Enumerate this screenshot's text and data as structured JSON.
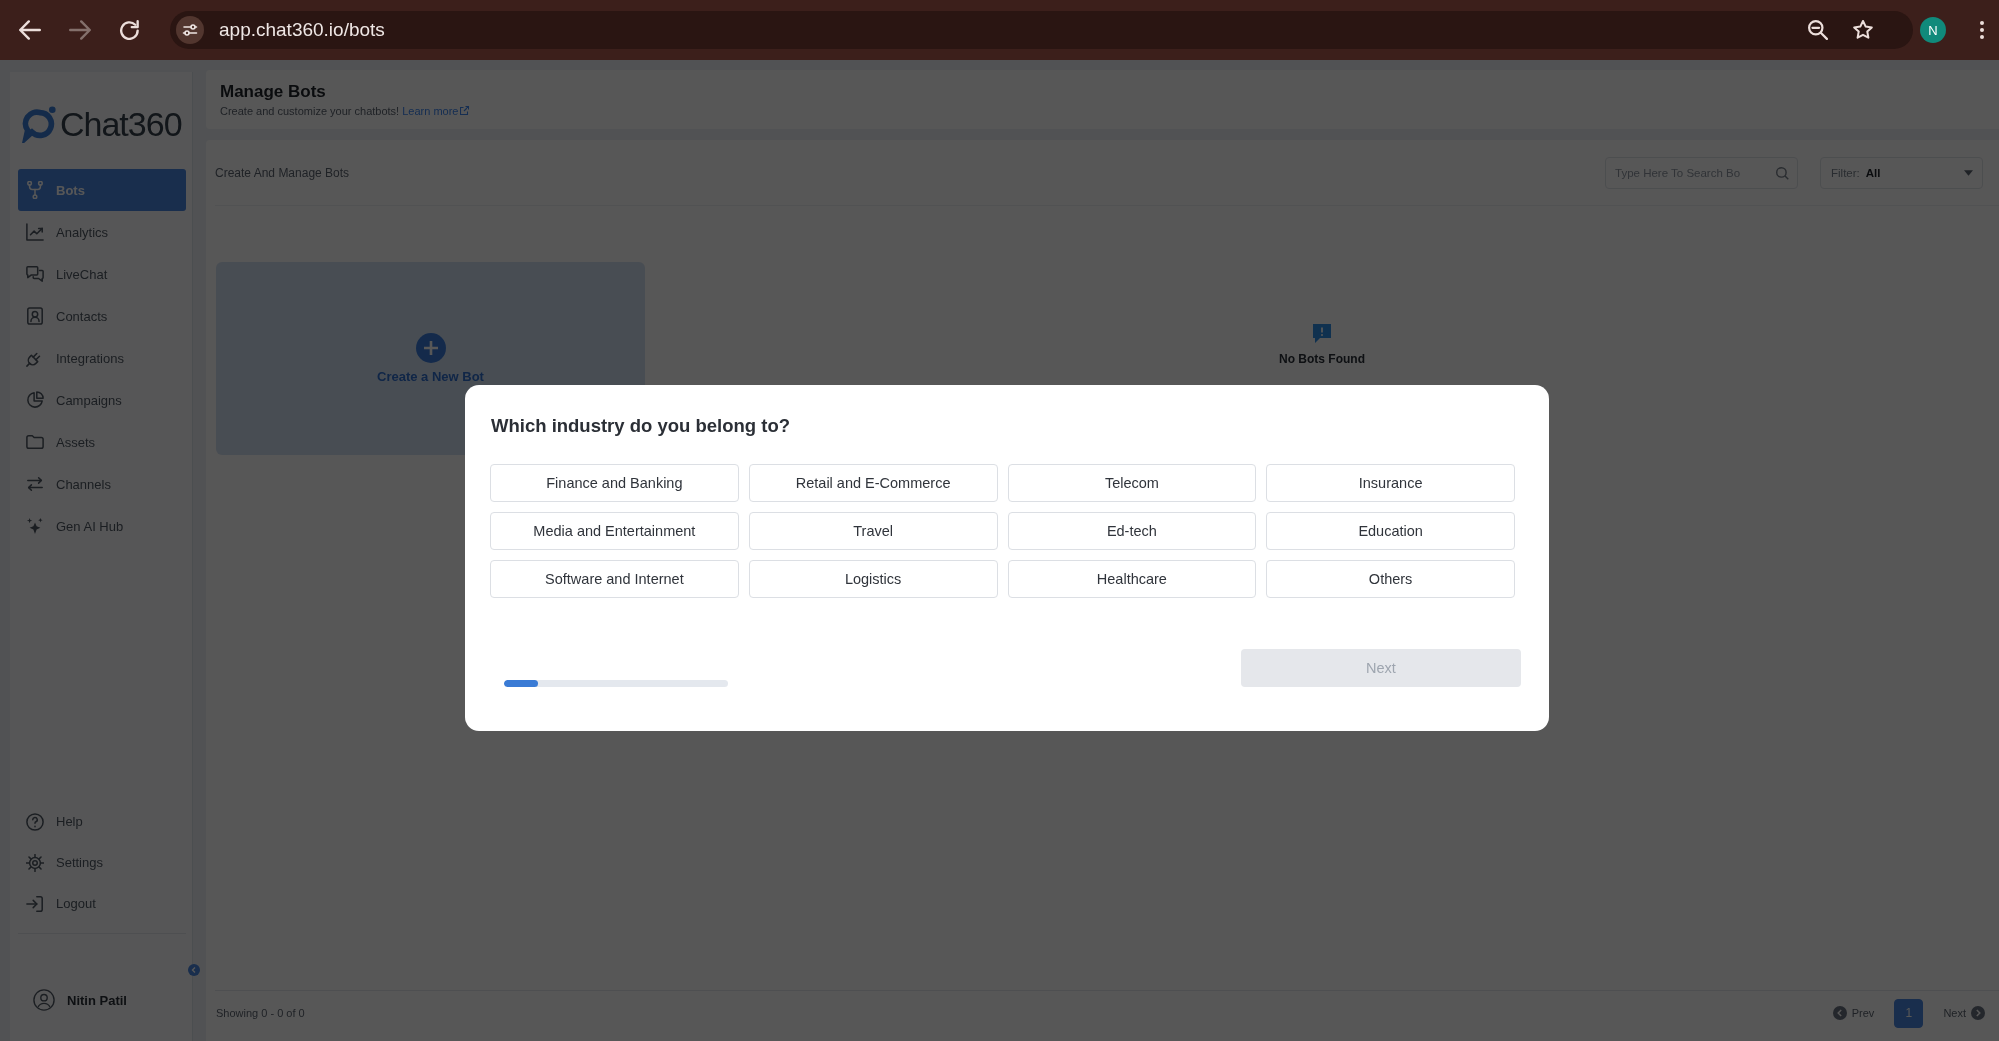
{
  "browser": {
    "url": "app.chat360.io/bots",
    "forward_disabled": true,
    "profile_initial": "N"
  },
  "sidebar": {
    "logo_text": "Chat360",
    "items": [
      {
        "label": "Bots",
        "selected": true
      },
      {
        "label": "Analytics",
        "selected": false
      },
      {
        "label": "LiveChat",
        "selected": false
      },
      {
        "label": "Contacts",
        "selected": false
      },
      {
        "label": "Integrations",
        "selected": false
      },
      {
        "label": "Campaigns",
        "selected": false
      },
      {
        "label": "Assets",
        "selected": false
      },
      {
        "label": "Channels",
        "selected": false
      },
      {
        "label": "Gen AI Hub",
        "selected": false
      }
    ],
    "bottom_items": [
      {
        "label": "Help"
      },
      {
        "label": "Settings"
      },
      {
        "label": "Logout"
      }
    ],
    "user": {
      "name": "Nitin Patil"
    }
  },
  "header": {
    "title": "Manage Bots",
    "subtitle": "Create and customize your chatbots!",
    "link": "Learn more"
  },
  "panel": {
    "title": "Create And Manage Bots",
    "search": {
      "placeholder": "Type Here To Search Bo"
    },
    "filter": {
      "label": "Filter:",
      "value": "All"
    },
    "create_card": {
      "label": "Create a New Bot"
    },
    "empty_state": {
      "text": "No Bots Found"
    },
    "footer": {
      "showing": "Showing 0 - 0 of 0",
      "prev": "Prev",
      "pages": [
        {
          "label": "1",
          "selected": true
        }
      ],
      "next": "Next"
    }
  },
  "modal": {
    "title": "Which industry do you belong to?",
    "options": [
      {
        "label": "Finance and Banking",
        "selected": false
      },
      {
        "label": "Retail and E-Commerce",
        "selected": false
      },
      {
        "label": "Telecom",
        "selected": false
      },
      {
        "label": "Insurance",
        "selected": false
      },
      {
        "label": "Media and Entertainment",
        "selected": false
      },
      {
        "label": "Travel",
        "selected": false
      },
      {
        "label": "Ed-tech",
        "selected": false
      },
      {
        "label": "Education",
        "selected": false
      },
      {
        "label": "Software and Internet",
        "selected": false
      },
      {
        "label": "Logistics",
        "selected": false
      },
      {
        "label": "Healthcare",
        "selected": false
      },
      {
        "label": "Others",
        "selected": false
      }
    ],
    "progress": {
      "level": 0.15
    },
    "next_button": {
      "label": "Next",
      "disabled": true
    }
  }
}
